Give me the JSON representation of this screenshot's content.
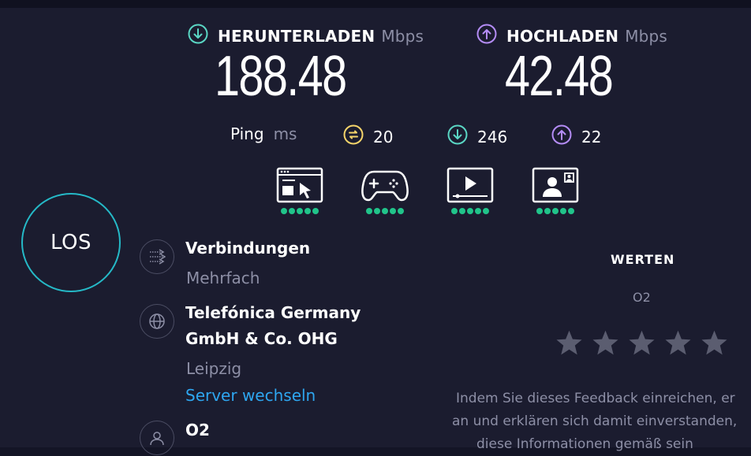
{
  "download": {
    "label": "HERUNTERLADEN",
    "unit": "Mbps",
    "value": "188.48"
  },
  "upload": {
    "label": "HOCHLADEN",
    "unit": "Mbps",
    "value": "42.48"
  },
  "ping": {
    "label": "Ping",
    "unit": "ms",
    "idle": "20",
    "download": "246",
    "upload": "22"
  },
  "apps": [
    {
      "name": "web-browsing",
      "rating": 5
    },
    {
      "name": "gaming",
      "rating": 5
    },
    {
      "name": "video-streaming",
      "rating": 5
    },
    {
      "name": "video-chat",
      "rating": 5
    }
  ],
  "go_label": "LOS",
  "connections": {
    "title": "Verbindungen",
    "value": "Mehrfach"
  },
  "server": {
    "line1": "Telefónica Germany",
    "line2": "GmbH & Co. OHG",
    "location": "Leipzig",
    "change_label": "Server wechseln"
  },
  "isp": {
    "name": "O2"
  },
  "rating": {
    "title": "WERTEN",
    "provider": "O2",
    "stars": 5
  },
  "feedback": {
    "line1": "Indem Sie dieses Feedback einreichen, er",
    "line2": "an und erklären sich damit einverstanden,",
    "line3": "diese Informationen gemäß sein"
  },
  "colors": {
    "download": "#5ad6c4",
    "upload": "#b48cf5",
    "idle": "#f5d46a",
    "good": "#21c48a",
    "link": "#2ea6f0",
    "ring": "#25b9c7"
  }
}
